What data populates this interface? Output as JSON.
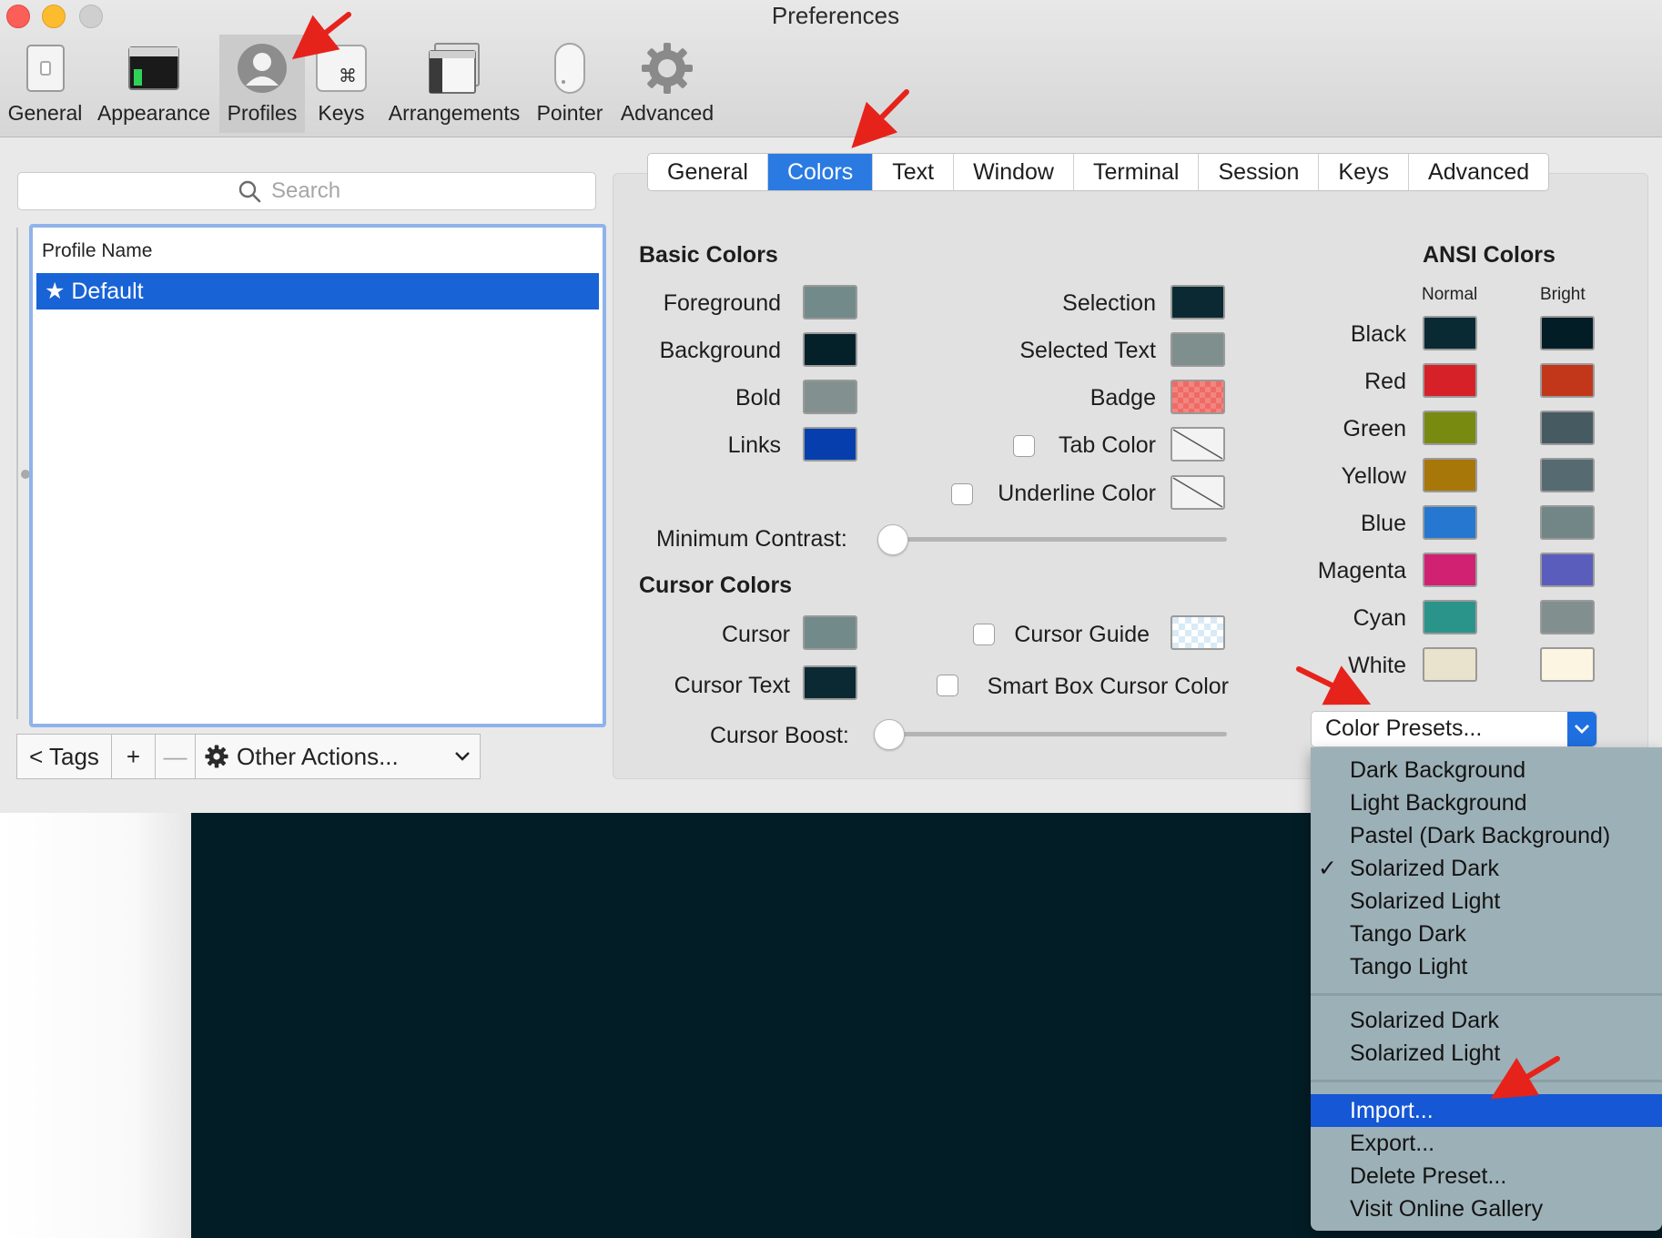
{
  "window": {
    "title": "Preferences"
  },
  "toolbar": {
    "items": [
      {
        "label": "General",
        "icon": "general-icon"
      },
      {
        "label": "Appearance",
        "icon": "appearance-icon"
      },
      {
        "label": "Profiles",
        "icon": "profiles-icon",
        "selected": true
      },
      {
        "label": "Keys",
        "icon": "keys-icon"
      },
      {
        "label": "Arrangements",
        "icon": "arrangements-icon"
      },
      {
        "label": "Pointer",
        "icon": "pointer-icon"
      },
      {
        "label": "Advanced",
        "icon": "advanced-icon"
      }
    ]
  },
  "profiles": {
    "search_placeholder": "Search",
    "header": "Profile Name",
    "rows": [
      {
        "name": "★ Default",
        "selected": true
      }
    ],
    "tags_button": "< Tags",
    "add_button": "+",
    "remove_button": "—",
    "other_actions": "Other Actions..."
  },
  "tabs": [
    {
      "label": "General"
    },
    {
      "label": "Colors",
      "selected": true
    },
    {
      "label": "Text"
    },
    {
      "label": "Window"
    },
    {
      "label": "Terminal"
    },
    {
      "label": "Session"
    },
    {
      "label": "Keys"
    },
    {
      "label": "Advanced"
    }
  ],
  "basic_colors": {
    "title": "Basic Colors",
    "foreground": {
      "label": "Foreground",
      "color": "#738a8a"
    },
    "background": {
      "label": "Background",
      "color": "#04212a"
    },
    "bold": {
      "label": "Bold",
      "color": "#82918f"
    },
    "links": {
      "label": "Links",
      "color": "#063fad"
    },
    "selection": {
      "label": "Selection",
      "color": "#0b2932"
    },
    "selected_text": {
      "label": "Selected Text",
      "color": "#7f8f8e"
    },
    "badge": {
      "label": "Badge",
      "color": "#ef6a64"
    },
    "tab_color": {
      "label": "Tab Color"
    },
    "underline_color": {
      "label": "Underline Color"
    },
    "min_contrast": {
      "label": "Minimum Contrast:",
      "value": 0
    }
  },
  "cursor_colors": {
    "title": "Cursor Colors",
    "cursor": {
      "label": "Cursor",
      "color": "#738a8a"
    },
    "cursor_text": {
      "label": "Cursor Text",
      "color": "#0b2932"
    },
    "cursor_guide": {
      "label": "Cursor Guide"
    },
    "smart_box": {
      "label": "Smart Box Cursor Color"
    },
    "cursor_boost": {
      "label": "Cursor Boost:",
      "value": 0
    }
  },
  "ansi": {
    "title": "ANSI Colors",
    "normal_header": "Normal",
    "bright_header": "Bright",
    "rows": [
      {
        "name": "Black",
        "normal": "#0a2a33",
        "bright": "#021d26"
      },
      {
        "name": "Red",
        "normal": "#d62129",
        "bright": "#c2371a"
      },
      {
        "name": "Green",
        "normal": "#798a10",
        "bright": "#465a61"
      },
      {
        "name": "Yellow",
        "normal": "#a87709",
        "bright": "#566a71"
      },
      {
        "name": "Blue",
        "normal": "#2577d0",
        "bright": "#728688"
      },
      {
        "name": "Magenta",
        "normal": "#d02173",
        "bright": "#5b5dbc"
      },
      {
        "name": "Cyan",
        "normal": "#2a948a",
        "bright": "#818f8f"
      },
      {
        "name": "White",
        "normal": "#e9e2cc",
        "bright": "#fcf5e1"
      }
    ]
  },
  "presets": {
    "button_label": "Color Presets...",
    "menu_group1": [
      "Dark Background",
      "Light Background",
      "Pastel (Dark Background)",
      "Solarized Dark",
      "Solarized Light",
      "Tango Dark",
      "Tango Light"
    ],
    "menu_group2": [
      "Solarized Dark",
      "Solarized Light"
    ],
    "menu_group3": [
      "Import...",
      "Export...",
      "Delete Preset...",
      "Visit Online Gallery"
    ],
    "checked": "Solarized Dark",
    "highlighted": "Import...",
    "checkmark": "✓"
  },
  "colors": {
    "accent": "#1863d6",
    "annotation_arrow": "#e6231b",
    "terminal_bg": "#031d26"
  }
}
